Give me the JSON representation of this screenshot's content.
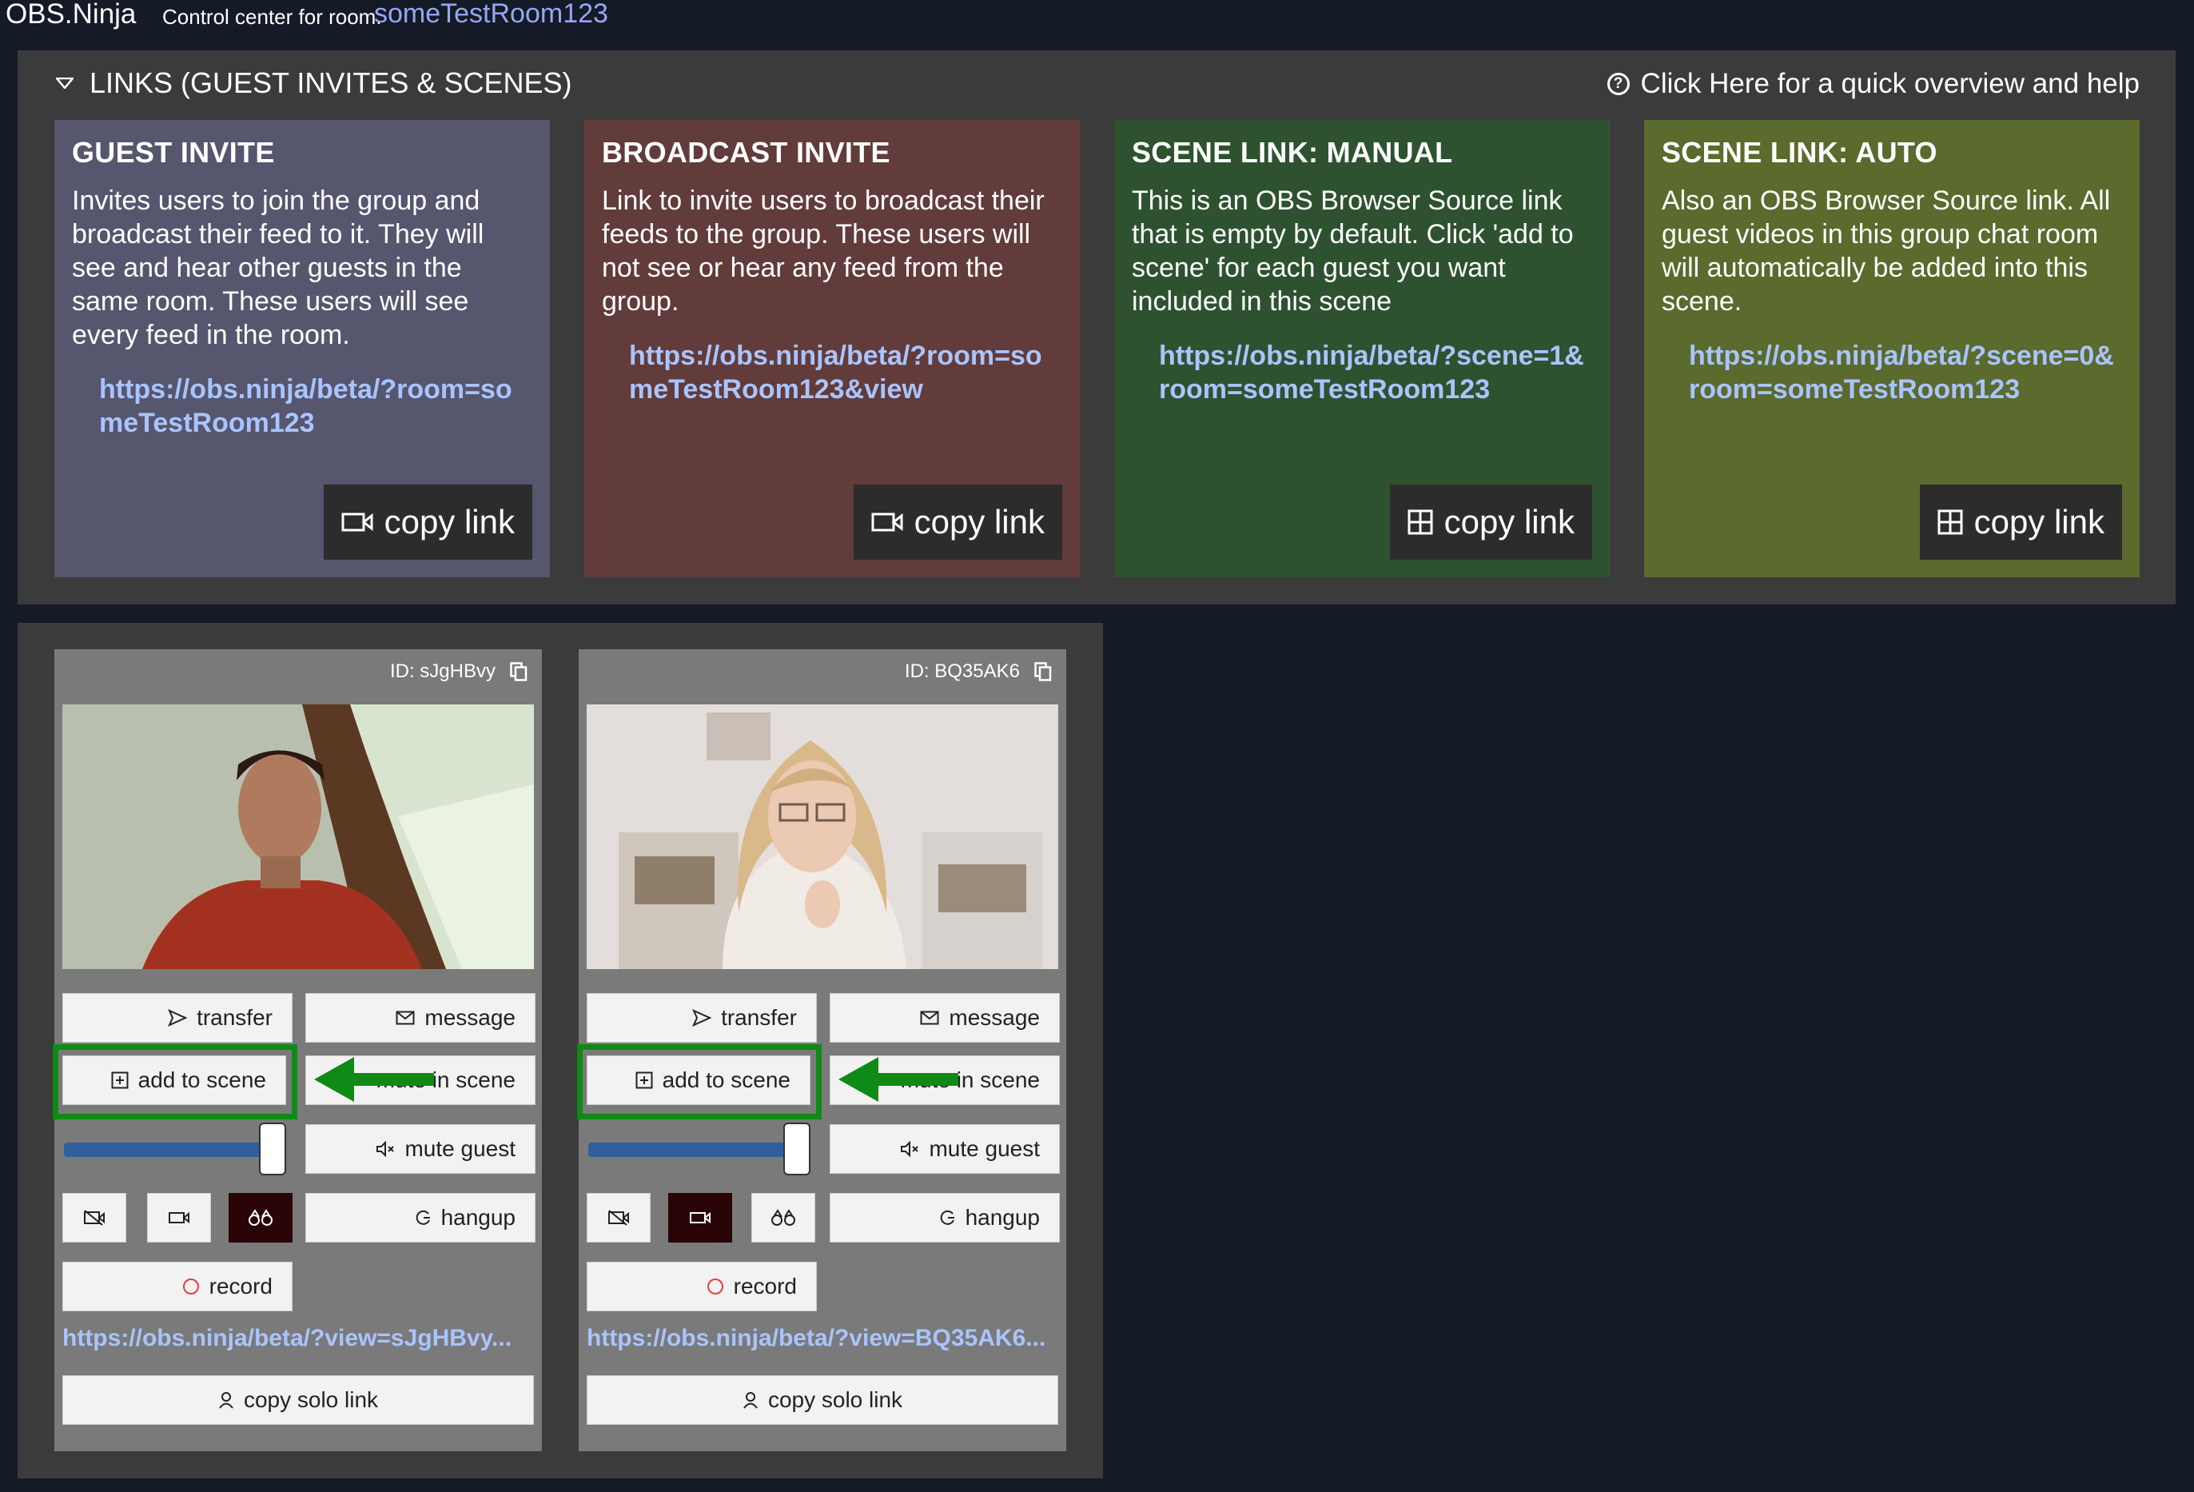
{
  "header": {
    "brand": "OBS.Ninja",
    "control_label": "Control center for room:",
    "room_name": "someTestRoom123"
  },
  "links_section": {
    "title": "LINKS (GUEST INVITES & SCENES)",
    "help_text": "Click Here for a quick overview and help",
    "cards": [
      {
        "title": "GUEST INVITE",
        "description": "Invites users to join the group and broadcast their feed to it. They will see and hear other guests in the same room. These users will see every feed in the room.",
        "link": "https://obs.ninja/beta/?room=someTestRoom123",
        "button": "copy link",
        "icon": "video-camera-icon",
        "color": "#56566e"
      },
      {
        "title": "BROADCAST INVITE",
        "description": "Link to invite users to broadcast their feeds to the group. These users will not see or hear any feed from the group.",
        "link": "https://obs.ninja/beta/?room=someTestRoom123&view",
        "button": "copy link",
        "icon": "video-camera-icon",
        "color": "#623b3b"
      },
      {
        "title": "SCENE LINK: MANUAL",
        "description": "This is an OBS Browser Source link that is empty by default. Click 'add to scene' for each guest you want included in this scene",
        "link": "https://obs.ninja/beta/?scene=1&room=someTestRoom123",
        "button": "copy link",
        "icon": "grid-icon",
        "color": "#2e5230"
      },
      {
        "title": "SCENE LINK: AUTO",
        "description": "Also an OBS Browser Source link. All guest videos in this group chat room will automatically be added into this scene.",
        "link": "https://obs.ninja/beta/?scene=0&room=someTestRoom123",
        "button": "copy link",
        "icon": "grid-icon",
        "color": "#5b6a2d"
      }
    ]
  },
  "guests": [
    {
      "id": "ID: sJgHBvy",
      "transfer": "transfer",
      "message": "message",
      "add_to_scene": "add to scene",
      "mute_in_scene": "mute in scene",
      "mute_guest": "mute guest",
      "hangup": "hangup",
      "record": "record",
      "solo_url": "https://obs.ninja/beta/?view=sJgHBvy...",
      "copy_solo": "copy solo link",
      "volume": 0.93
    },
    {
      "id": "ID: BQ35AK6",
      "transfer": "transfer",
      "message": "message",
      "add_to_scene": "add to scene",
      "mute_in_scene": "mute in scene",
      "mute_guest": "mute guest",
      "hangup": "hangup",
      "record": "record",
      "solo_url": "https://obs.ninja/beta/?view=BQ35AK6...",
      "copy_solo": "copy solo link",
      "volume": 0.93
    }
  ],
  "colors": {
    "highlight": "#0f8a16",
    "link": "#a9c4ff",
    "room_name": "#98a6f2"
  }
}
